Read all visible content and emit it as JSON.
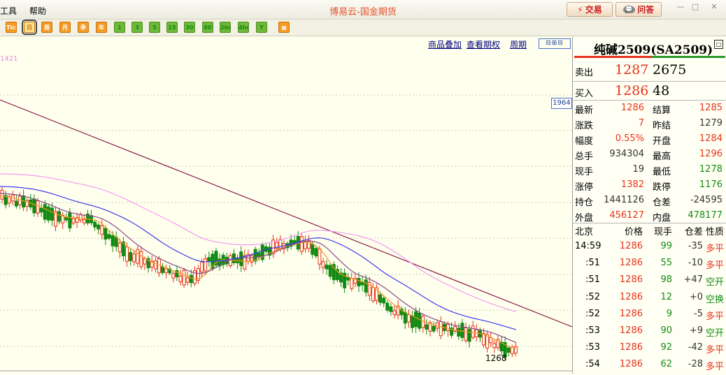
{
  "menu": [
    "工具",
    "帮助"
  ],
  "app_title": "博易云-国金期货",
  "buttons": {
    "trade": "交易",
    "qa": "问答"
  },
  "toolbar": [
    "Tick",
    "日",
    "周",
    "月",
    "季",
    "年",
    "1",
    "3",
    "5",
    "15",
    "30",
    "60",
    "2hr",
    "4hr",
    "Y"
  ],
  "chart_links": [
    "商品叠加",
    "查看期权",
    "周期"
  ],
  "chart_labels": {
    "top_left": "1421",
    "price_tag": "1964",
    "low_marker": "1268"
  },
  "colors": {
    "up": "#e8321a",
    "down": "#138a13",
    "ma_blue": "#3c3cf0",
    "ma_pink": "#f29af2",
    "ma_purple": "#8a4a8a",
    "ma_orange": "#f59a23",
    "trend": "#8a1a4a"
  },
  "quote": {
    "name": "纯碱2509(SA2509)",
    "ask_label": "卖出",
    "ask_price": "1287",
    "ask_vol": "2675",
    "bid_label": "买入",
    "bid_price": "1286",
    "bid_vol": "48",
    "stats": [
      [
        "最新",
        "1286",
        "结算",
        "1285"
      ],
      [
        "涨跌",
        "7",
        "昨结",
        "1279"
      ],
      [
        "幅度",
        "0.55%",
        "开盘",
        "1284"
      ],
      [
        "总手",
        "934304",
        "最高",
        "1296"
      ],
      [
        "现手",
        "19",
        "最低",
        "1278"
      ],
      [
        "涨停",
        "1382",
        "跌停",
        "1176"
      ],
      [
        "持仓",
        "1441126",
        "仓差",
        "-24595"
      ],
      [
        "外盘",
        "456127",
        "内盘",
        "478177"
      ]
    ],
    "ticks_header": [
      "北京",
      "价格",
      "现手",
      "仓差",
      "性质"
    ],
    "ticks": [
      [
        "14:59",
        "1286",
        "99",
        "-35",
        "多平"
      ],
      [
        ":51",
        "1286",
        "55",
        "-10",
        "多平"
      ],
      [
        ":51",
        "1286",
        "98",
        "+47",
        "空开"
      ],
      [
        ":52",
        "1286",
        "12",
        "+0",
        "空换"
      ],
      [
        ":52",
        "1286",
        "9",
        "-5",
        "多平"
      ],
      [
        ":53",
        "1286",
        "90",
        "+9",
        "空开"
      ],
      [
        ":53",
        "1286",
        "92",
        "-42",
        "多平"
      ],
      [
        ":54",
        "1286",
        "62",
        "-28",
        "多平"
      ]
    ]
  }
}
